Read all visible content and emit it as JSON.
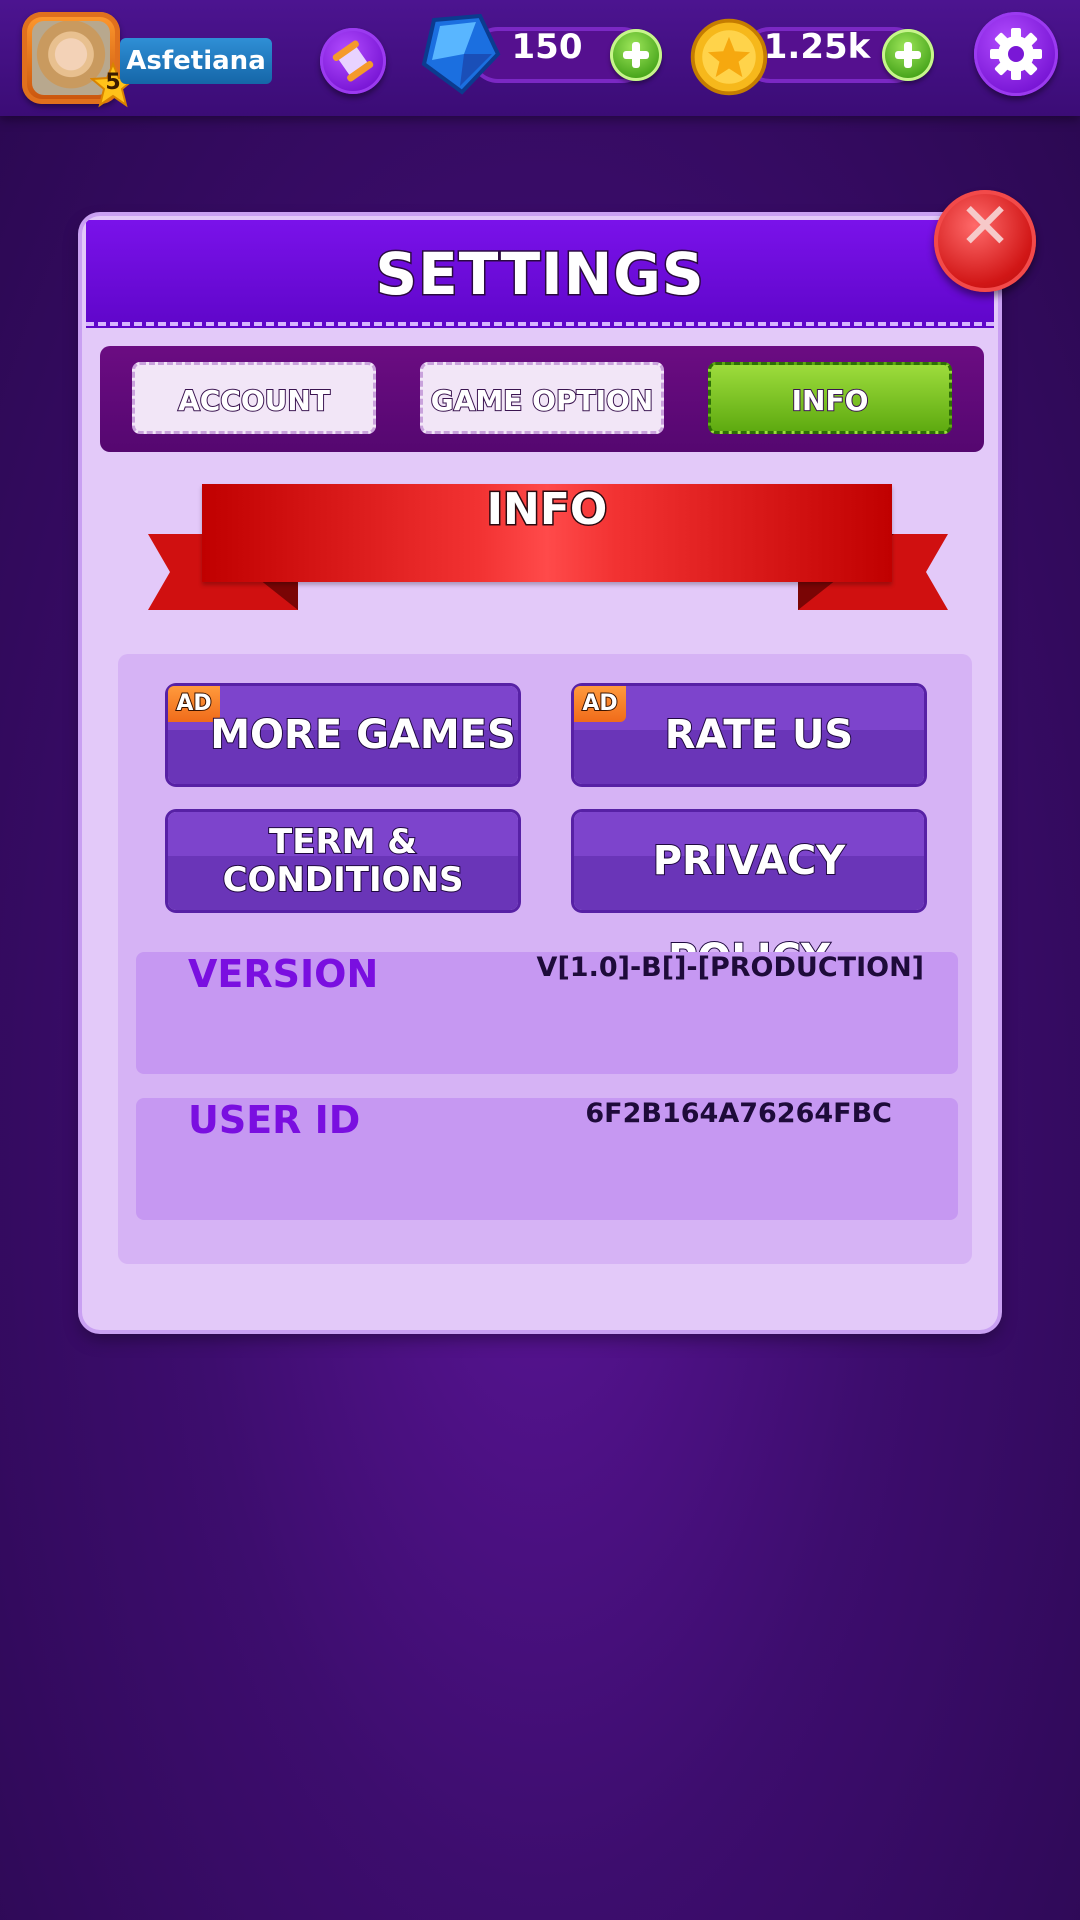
{
  "topbar": {
    "player_name": "Asfetiana",
    "level": "5",
    "gems": "150",
    "coins": "1.25k"
  },
  "icons": {
    "avatar": "player-portrait",
    "level": "star-icon",
    "scroll": "scroll-icon",
    "gem": "blue-gem-icon",
    "coin": "gold-coin-icon",
    "plus": "plus-icon",
    "settings": "gear-icon",
    "close": "close-icon"
  },
  "settings": {
    "title": "SETTINGS",
    "tabs": [
      {
        "label": "ACCOUNT",
        "active": false
      },
      {
        "label": "GAME OPTION",
        "active": false
      },
      {
        "label": "INFO",
        "active": true
      }
    ],
    "section_title": "INFO",
    "buttons": {
      "more_games": {
        "label": "MORE GAMES",
        "badge": "AD"
      },
      "rate_us": {
        "label": "RATE US",
        "badge": "AD"
      },
      "terms": {
        "label_line1": "TERM &",
        "label_line2": "CONDITIONS"
      },
      "privacy": {
        "label": "PRIVACY POLICY"
      }
    },
    "version": {
      "label": "VERSION",
      "value": "V[1.0]-B[]-[PRODUCTION]"
    },
    "user_id": {
      "label": "USER ID",
      "value": "6F2B164A76264FBC"
    }
  },
  "colors": {
    "background": "#3d0d6e",
    "panel": "#e3c9f9",
    "header": "#6a0bd6",
    "tab_active": "#7cc525",
    "ribbon": "#e12a2a",
    "button": "#7340c2",
    "label_accent": "#7a0fe0"
  }
}
